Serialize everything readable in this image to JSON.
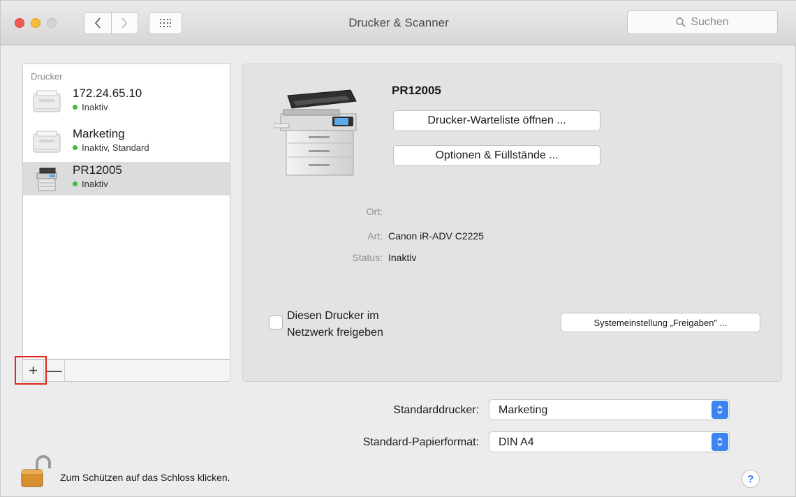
{
  "window": {
    "title": "Drucker & Scanner",
    "search_placeholder": "Suchen"
  },
  "sidebar": {
    "header": "Drucker",
    "items": [
      {
        "name": "172.24.65.10",
        "status": "Inaktiv",
        "icon": "printer-generic-icon",
        "selected": false
      },
      {
        "name": "Marketing",
        "status": "Inaktiv, Standard",
        "icon": "printer-generic-icon",
        "selected": false
      },
      {
        "name": "PR12005",
        "status": "Inaktiv",
        "icon": "printer-multifunction-icon",
        "selected": true
      }
    ],
    "add_label": "+",
    "remove_label": "—"
  },
  "detail": {
    "printer_name": "PR12005",
    "queue_button": "Drucker-Warteliste öffnen ...",
    "options_button": "Optionen & Füllstände ...",
    "location_label": "Ort:",
    "location_value": "",
    "kind_label": "Art:",
    "kind_value": "Canon iR-ADV C2225",
    "status_label": "Status:",
    "status_value": "Inaktiv",
    "share_line1": "Diesen Drucker im",
    "share_line2": "Netzwerk freigeben",
    "share_checked": false,
    "sharing_prefs_button": "Systemeinstellung „Freigaben\" ..."
  },
  "defaults": {
    "printer_label": "Standarddrucker:",
    "printer_value": "Marketing",
    "paper_label": "Standard-Papierformat:",
    "paper_value": "DIN A4"
  },
  "footer": {
    "lock_text": "Zum Schützen auf das Schloss klicken.",
    "help_label": "?"
  },
  "colors": {
    "accent": "#3b84f2",
    "status_dot": "#3fbf3a",
    "highlight": "#e0241f"
  }
}
